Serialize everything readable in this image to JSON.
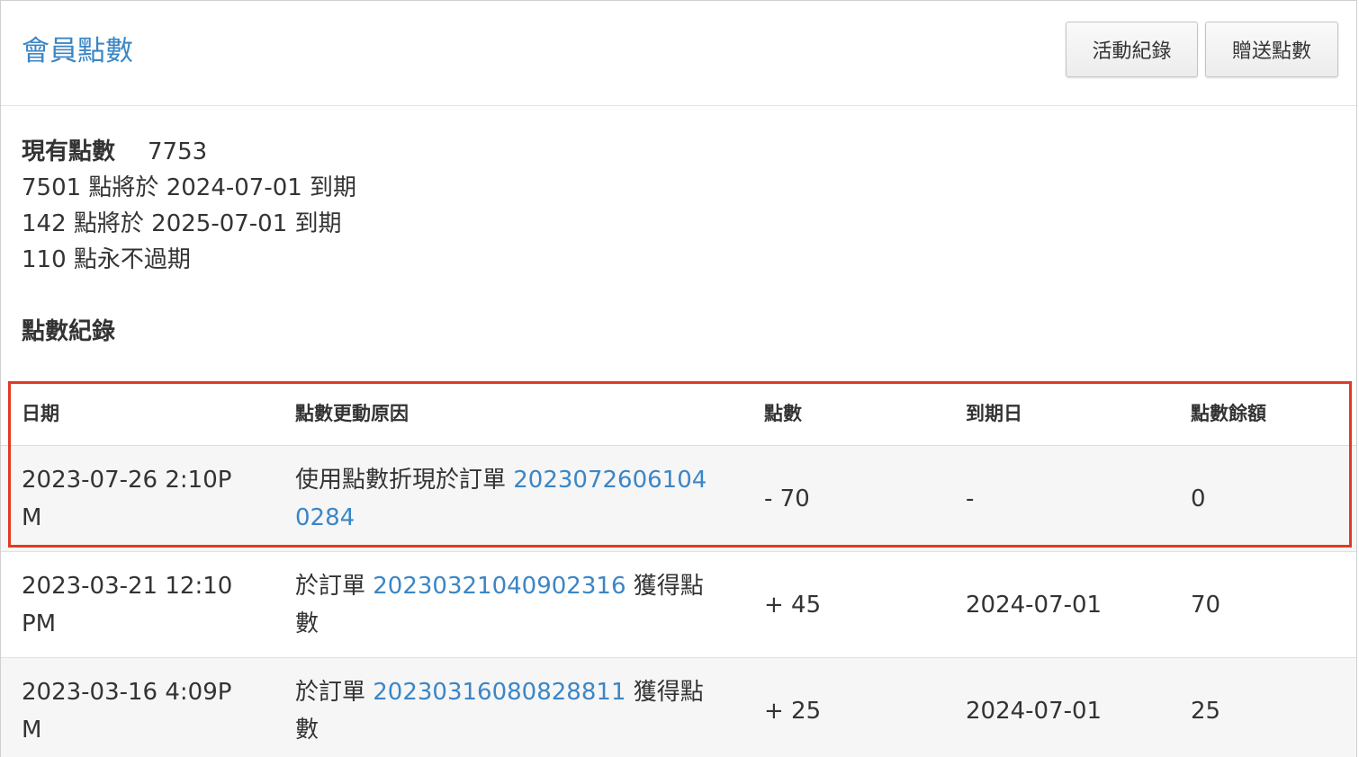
{
  "header": {
    "title": "會員點數",
    "buttons": {
      "activity_label": "活動紀錄",
      "gift_label": "贈送點數"
    }
  },
  "summary": {
    "current_label": "現有點數",
    "current_value": "7753",
    "lines": [
      "7501 點將於 2024-07-01 到期",
      "142 點將於 2025-07-01 到期",
      "110 點永不過期"
    ]
  },
  "records": {
    "title": "點數紀錄",
    "columns": [
      "日期",
      "點數更動原因",
      "點數",
      "到期日",
      "點數餘額"
    ],
    "rows": [
      {
        "date": "2023-07-26 2:10PM",
        "reason_prefix": "使用點數折現於訂單 ",
        "order": "20230726061040284",
        "reason_suffix": "",
        "points": "- 70",
        "expiry": "-",
        "balance": "0"
      },
      {
        "date": "2023-03-21 12:10PM",
        "reason_prefix": "於訂單 ",
        "order": "20230321040902316",
        "reason_suffix": " 獲得點數",
        "points": "+ 45",
        "expiry": "2024-07-01",
        "balance": "70"
      },
      {
        "date": "2023-03-16 4:09PM",
        "reason_prefix": "於訂單 ",
        "order": "20230316080828811",
        "reason_suffix": " 獲得點數",
        "points": "+ 25",
        "expiry": "2024-07-01",
        "balance": "25"
      }
    ]
  },
  "colors": {
    "link": "#3b86c6",
    "highlight": "#e03b24"
  }
}
